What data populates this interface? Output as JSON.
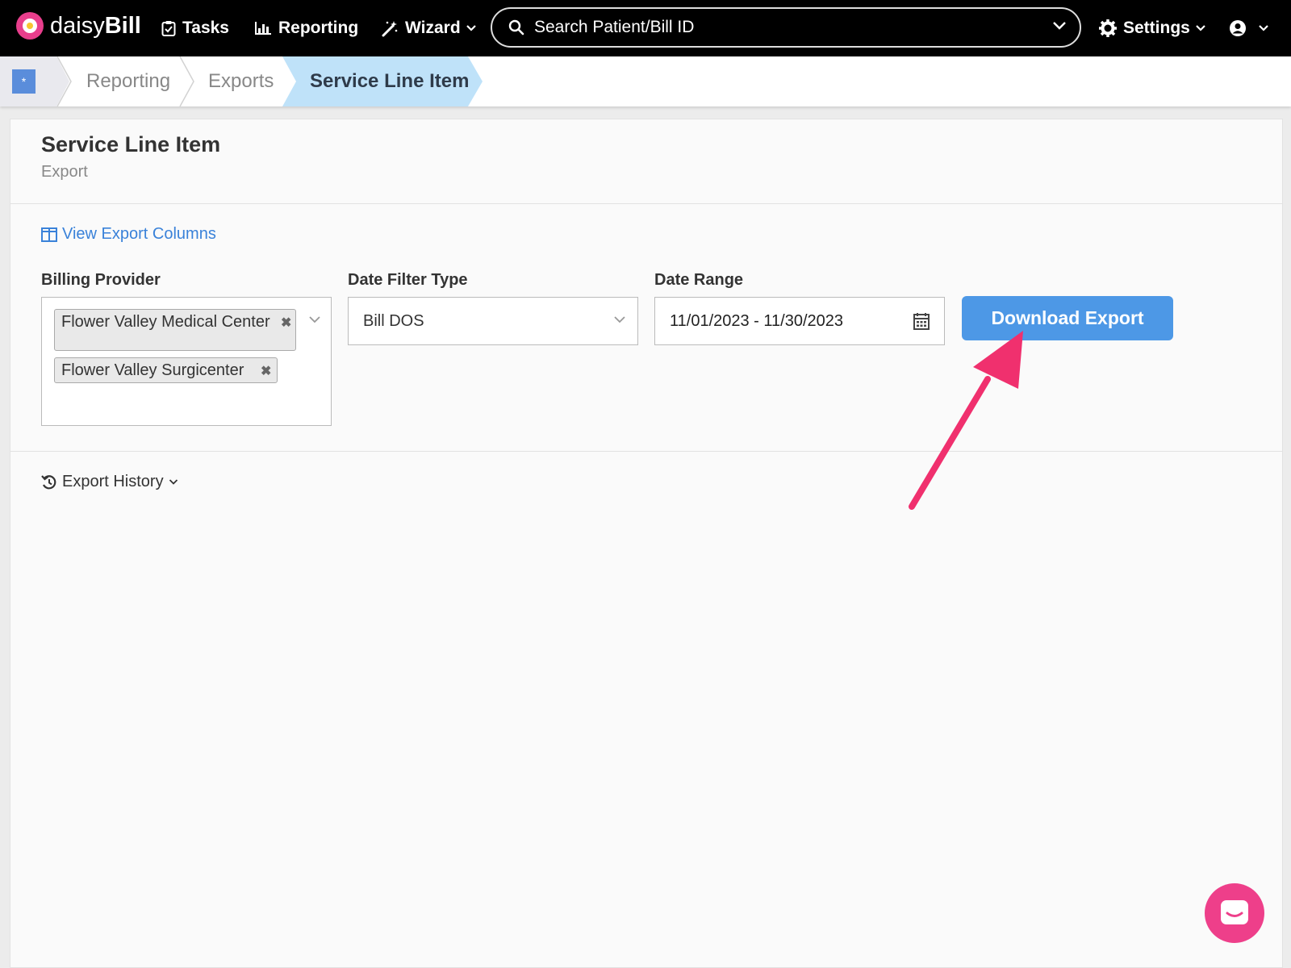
{
  "nav": {
    "brand_light": "daisy",
    "brand_bold": "Bill",
    "tasks": "Tasks",
    "reporting": "Reporting",
    "wizard": "Wizard",
    "search_placeholder": "Search Patient/Bill ID",
    "settings": "Settings"
  },
  "breadcrumb": [
    "Reporting",
    "Exports",
    "Service Line Item"
  ],
  "page": {
    "title": "Service Line Item",
    "subtitle": "Export",
    "view_columns": "View Export Columns",
    "billing_provider_label": "Billing Provider",
    "billing_providers": [
      "Flower Valley Medical Center",
      "Flower Valley Surgicenter"
    ],
    "date_filter_label": "Date Filter Type",
    "date_filter_value": "Bill DOS",
    "date_range_label": "Date Range",
    "date_range_value": "11/01/2023 - 11/30/2023",
    "download_button": "Download Export",
    "export_history": "Export History"
  },
  "colors": {
    "primary_button": "#4d98e6",
    "link": "#3a82d9",
    "annotation_arrow": "#f0306e",
    "active_crumb": "#bfe2f9",
    "chat_bubble": "#ee3f8a"
  },
  "icons": [
    "logo-flower-icon",
    "clipboard-check-icon",
    "bar-chart-icon",
    "magic-wand-icon",
    "search-icon",
    "gear-icon",
    "user-circle-icon",
    "chevron-down-icon",
    "columns-icon",
    "calendar-icon",
    "history-icon",
    "chat-icon"
  ]
}
